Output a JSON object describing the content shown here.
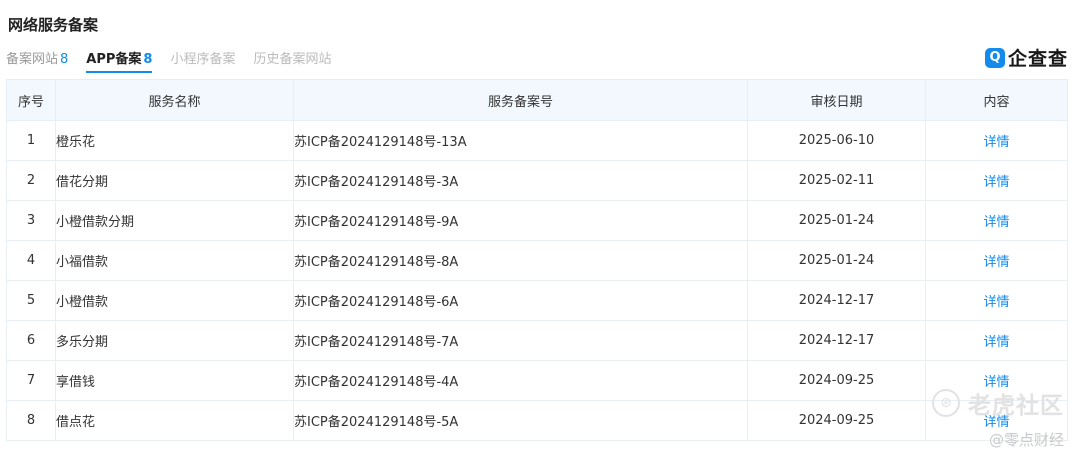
{
  "section": {
    "title": "网络服务备案"
  },
  "tabs": [
    {
      "label": "备案网站",
      "count": "8"
    },
    {
      "label": "APP备案",
      "count": "8"
    },
    {
      "label": "小程序备案",
      "count": ""
    },
    {
      "label": "历史备案网站",
      "count": ""
    }
  ],
  "brand": {
    "icon": "Q",
    "name": "企查查"
  },
  "table": {
    "headers": [
      "序号",
      "服务名称",
      "服务备案号",
      "审核日期",
      "内容"
    ],
    "rows": [
      {
        "index": "1",
        "name": "橙乐花",
        "record": "苏ICP备2024129148号-13A",
        "date": "2025-06-10",
        "action": "详情"
      },
      {
        "index": "2",
        "name": "借花分期",
        "record": "苏ICP备2024129148号-3A",
        "date": "2025-02-11",
        "action": "详情"
      },
      {
        "index": "3",
        "name": "小橙借款分期",
        "record": "苏ICP备2024129148号-9A",
        "date": "2025-01-24",
        "action": "详情"
      },
      {
        "index": "4",
        "name": "小福借款",
        "record": "苏ICP备2024129148号-8A",
        "date": "2025-01-24",
        "action": "详情"
      },
      {
        "index": "5",
        "name": "小橙借款",
        "record": "苏ICP备2024129148号-6A",
        "date": "2024-12-17",
        "action": "详情"
      },
      {
        "index": "6",
        "name": "多乐分期",
        "record": "苏ICP备2024129148号-7A",
        "date": "2024-12-17",
        "action": "详情"
      },
      {
        "index": "7",
        "name": "享借钱",
        "record": "苏ICP备2024129148号-4A",
        "date": "2024-09-25",
        "action": "详情"
      },
      {
        "index": "8",
        "name": "借点花",
        "record": "苏ICP备2024129148号-5A",
        "date": "2024-09-25",
        "action": "详情"
      }
    ]
  },
  "watermark": {
    "icon": "tiger-logo-icon",
    "main": "老虎社区",
    "sub": "@零点财经"
  },
  "colors": {
    "accent": "#128bed",
    "header_bg": "#f2f8fe",
    "border": "#e8eef3"
  }
}
